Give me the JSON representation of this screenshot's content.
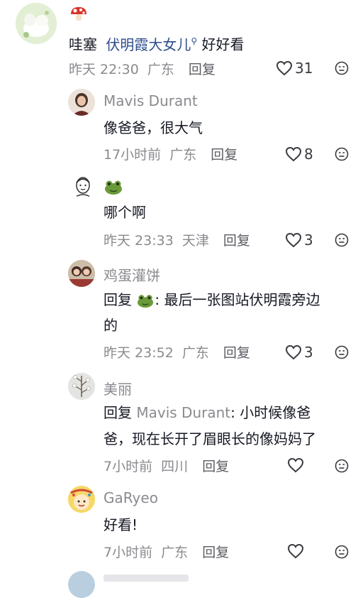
{
  "comments": [
    {
      "prefix": "哇塞",
      "mention": "伏明霞大女儿",
      "suffix": "好好看",
      "time": "昨天 22:30",
      "location": "广东",
      "reply_label": "回复",
      "likes": "31"
    },
    {
      "author": "Mavis Durant",
      "text": "像爸爸，很大气",
      "time": "17小时前",
      "location": "广东",
      "reply_label": "回复",
      "likes": "8"
    },
    {
      "author": "",
      "text": "哪个啊",
      "time": "昨天 23:33",
      "location": "天津",
      "reply_label": "回复",
      "likes": "3"
    },
    {
      "author": "鸡蛋灌饼",
      "reply_prefix": "回复",
      "text_line1": ": 最后一张图站伏明霞旁边",
      "text_line2": "的",
      "time": "昨天 23:52",
      "location": "广东",
      "reply_label": "回复",
      "likes": "3"
    },
    {
      "author": "美丽",
      "reply_prefix": "回复",
      "reply_target": "Mavis Durant",
      "text_line1": ": 小时候像爸",
      "text_line2": "爸，现在长开了眉眼长的像妈妈了",
      "time": "7小时前",
      "location": "四川",
      "reply_label": "回复",
      "likes": ""
    },
    {
      "author": "GaRyeo",
      "text": "好看!",
      "time": "7小时前",
      "location": "广东",
      "reply_label": "回复",
      "likes": ""
    }
  ]
}
